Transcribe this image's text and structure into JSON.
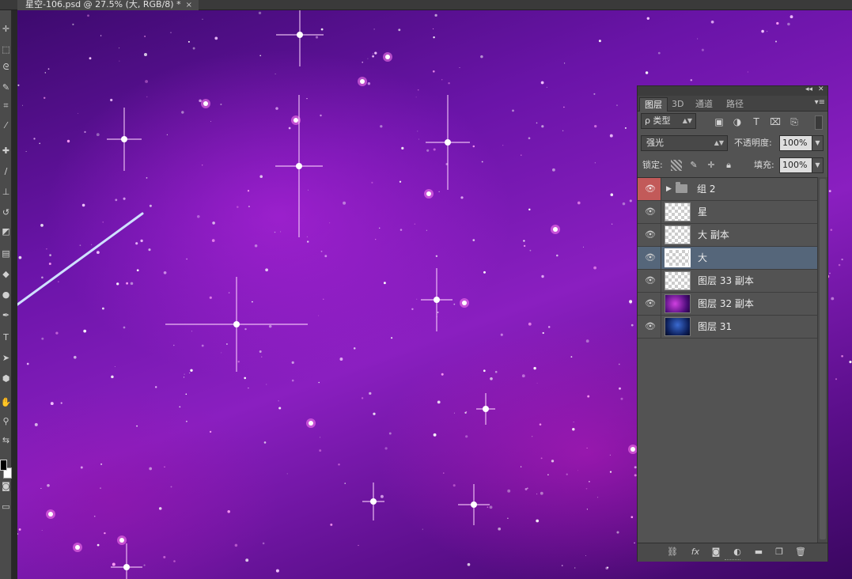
{
  "document": {
    "tab_title": "星空-106.psd @ 27.5% (大, RGB/8) *",
    "close_glyph": "×"
  },
  "tools": [
    {
      "name": "move-tool-icon",
      "glyph": "✛"
    },
    {
      "name": "marquee-tool-icon",
      "glyph": "⬚"
    },
    {
      "name": "lasso-tool-icon",
      "glyph": "ᘓ"
    },
    {
      "name": "quick-select-tool-icon",
      "glyph": "✎"
    },
    {
      "name": "crop-tool-icon",
      "glyph": "⌗"
    },
    {
      "name": "eyedropper-tool-icon",
      "glyph": "⁄"
    },
    {
      "name": "healing-tool-icon",
      "glyph": "✚"
    },
    {
      "name": "brush-tool-icon",
      "glyph": "∕"
    },
    {
      "name": "stamp-tool-icon",
      "glyph": "⊥"
    },
    {
      "name": "history-brush-icon",
      "glyph": "↺"
    },
    {
      "name": "eraser-tool-icon",
      "glyph": "◩"
    },
    {
      "name": "gradient-tool-icon",
      "glyph": "▤"
    },
    {
      "name": "blur-tool-icon",
      "glyph": "◆"
    },
    {
      "name": "dodge-tool-icon",
      "glyph": "●"
    },
    {
      "name": "pen-tool-icon",
      "glyph": "✒"
    },
    {
      "name": "type-tool-icon",
      "glyph": "T"
    },
    {
      "name": "path-select-tool-icon",
      "glyph": "➤"
    },
    {
      "name": "shape-tool-icon",
      "glyph": "⬢"
    },
    {
      "name": "hand-tool-icon",
      "glyph": "✋"
    },
    {
      "name": "zoom-tool-icon",
      "glyph": "⚲"
    },
    {
      "name": "swap-colors-icon",
      "glyph": "⇆"
    },
    {
      "name": "quick-mask-icon",
      "glyph": "◙"
    },
    {
      "name": "screen-mode-icon",
      "glyph": "▭"
    }
  ],
  "layers_panel": {
    "collapse_glyph": "◂◂",
    "close_glyph": "✕",
    "tabs": [
      {
        "label": "图层",
        "active": true
      },
      {
        "label": "3D",
        "active": false
      },
      {
        "label": "通道",
        "active": false
      },
      {
        "label": "路径",
        "active": false
      }
    ],
    "menu_glyph": "▾≡",
    "filter_kind": "ρ 类型",
    "filter_icons": [
      "image-filter-icon",
      "adjustment-filter-icon",
      "type-filter-icon",
      "shape-filter-icon",
      "smart-object-filter-icon"
    ],
    "blend_mode": "强光",
    "opacity_label": "不透明度:",
    "opacity_value": "100%",
    "lock_label": "锁定:",
    "fill_label": "填充:",
    "fill_value": "100%",
    "layers": [
      {
        "name": "组 2",
        "kind": "group",
        "selected": false
      },
      {
        "name": "星",
        "kind": "transparent",
        "selected": false
      },
      {
        "name": "大 副本",
        "kind": "transparent",
        "selected": false
      },
      {
        "name": "大",
        "kind": "transparent",
        "selected": true
      },
      {
        "name": "图层 33 副本",
        "kind": "transparent",
        "selected": false
      },
      {
        "name": "图层 32 副本",
        "kind": "purple",
        "selected": false
      },
      {
        "name": "图层 31",
        "kind": "blue",
        "selected": false
      }
    ],
    "footer_buttons": [
      {
        "name": "link-layers-icon",
        "glyph": "⛓"
      },
      {
        "name": "fx-icon",
        "glyph": "fx"
      },
      {
        "name": "add-mask-icon",
        "glyph": "◙"
      },
      {
        "name": "adjustment-layer-icon",
        "glyph": "◐"
      },
      {
        "name": "new-group-icon",
        "glyph": "▬"
      },
      {
        "name": "new-layer-icon",
        "glyph": "❐"
      },
      {
        "name": "delete-layer-icon",
        "glyph": "🗑"
      }
    ]
  },
  "colors": {
    "selection_highlight": "#55667a",
    "group_eye_cell": "#c25a59",
    "canvas_base": "#6a14a8"
  }
}
